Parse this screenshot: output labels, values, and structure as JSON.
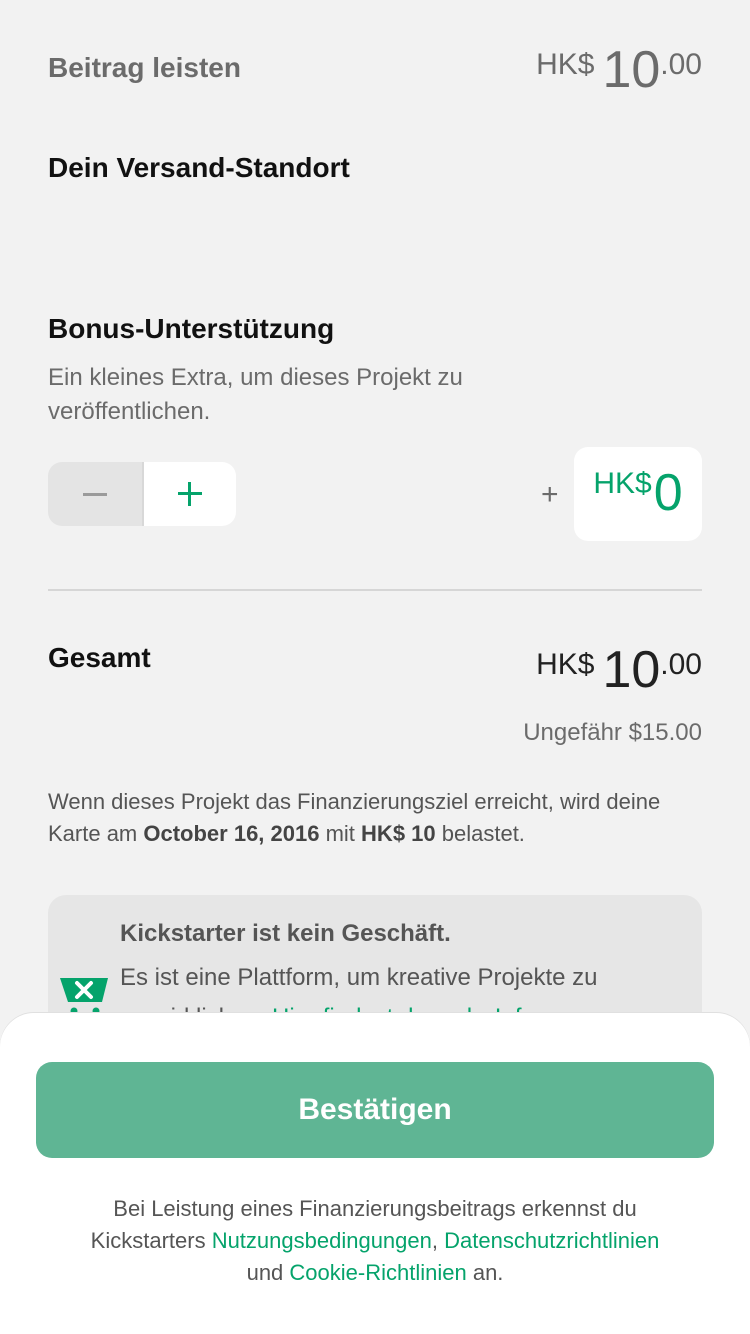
{
  "pledge": {
    "label": "Beitrag leisten",
    "currency": "HK$",
    "whole": "10",
    "decimal": ".00"
  },
  "shipping": {
    "title": "Dein Versand-Standort"
  },
  "bonus": {
    "title": "Bonus-Unterstützung",
    "description": "Ein kleines Extra, um dieses Projekt zu veröffentlichen.",
    "plus_sign": "+",
    "currency": "HK$",
    "amount": "0"
  },
  "total": {
    "label": "Gesamt",
    "currency": "HK$",
    "whole": "10",
    "decimal": ".00",
    "approx": "Ungefähr $15.00"
  },
  "charge_note": {
    "part1": "Wenn dieses Projekt das Finanzierungsziel erreicht, wird deine Karte am ",
    "date": "October 16, 2016",
    "part2": " mit ",
    "amount": "HK$ 10",
    "part3": " belastet."
  },
  "info": {
    "title": "Kickstarter ist kein Geschäft.",
    "text": "Es ist eine Plattform, um kreative Projekte zu verwirklichen. ",
    "link": "Hier findest du mehr Info zur"
  },
  "sheet": {
    "confirm_label": "Bestätigen",
    "terms_part1": "Bei Leistung eines Finanzierungsbeitrags erkennst du Kickstarters ",
    "terms_link1": "Nutzungsbedingungen",
    "terms_part2": ", ",
    "terms_link2": "Datenschutzrichtlinien",
    "terms_part3": " und ",
    "terms_link3": "Cookie-Richtlinien",
    "terms_part4": " an."
  },
  "colors": {
    "accent": "#05a36b",
    "button": "#5fb594",
    "background": "#f2f2f2"
  }
}
